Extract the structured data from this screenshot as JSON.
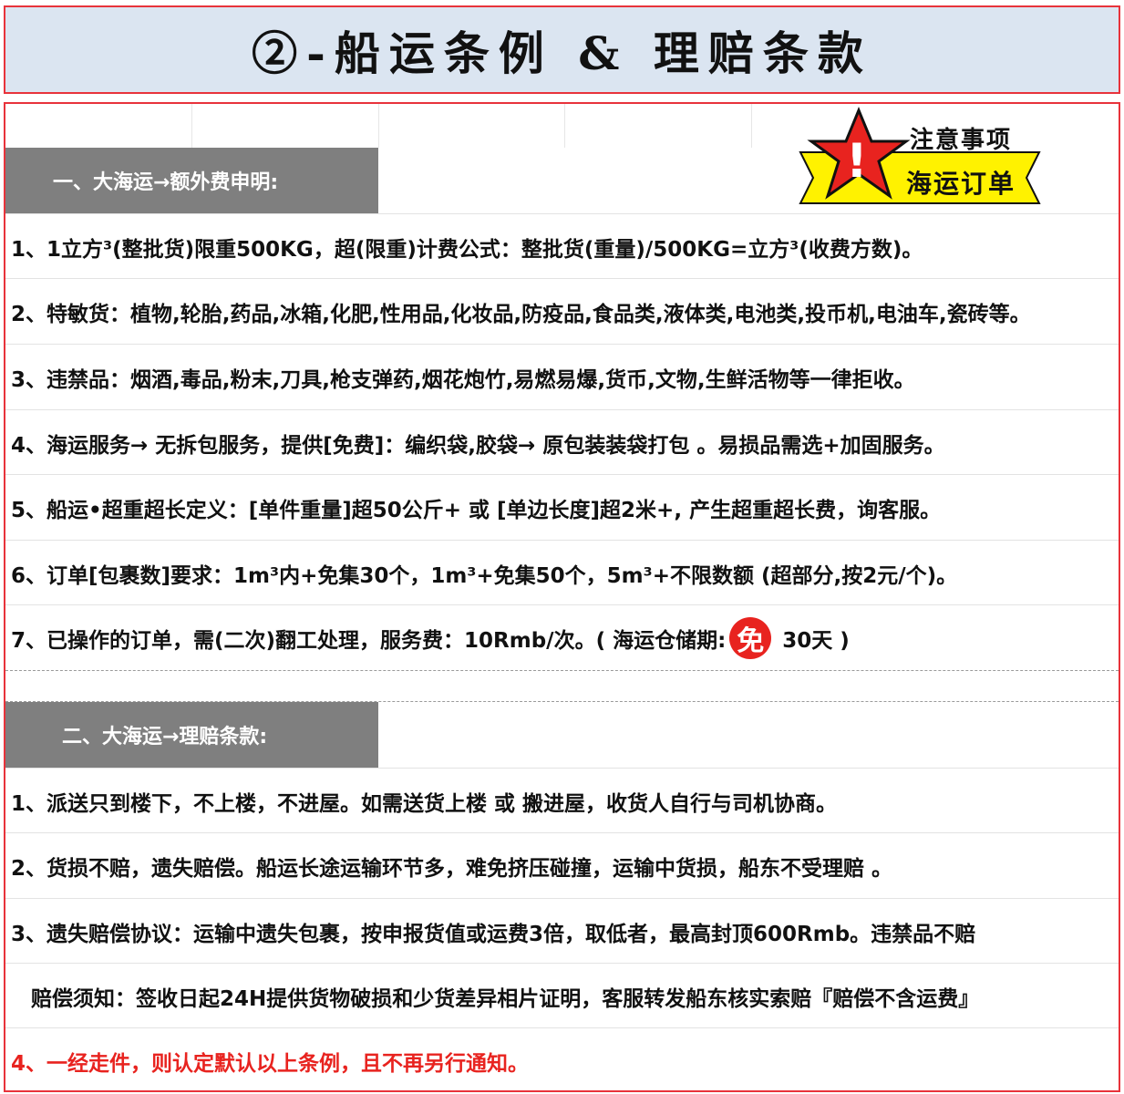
{
  "title": "②-船运条例 & 理赔条款",
  "notice": {
    "line1": "注意事项",
    "line2": "海运订单",
    "mark": "!"
  },
  "section1": {
    "header": "一、大海运→额外费申明:",
    "items": [
      "1、1立方³(整批货)限重500KG，超(限重)计费公式：整批货(重量)/500KG=立方³(收费方数)。",
      "2、特敏货：植物,轮胎,药品,冰箱,化肥,性用品,化妆品,防疫品,食品类,液体类,电池类,投币机,电油车,瓷砖等。",
      "3、违禁品：烟酒,毒品,粉末,刀具,枪支弹药,烟花炮竹,易燃易爆,货币,文物,生鲜活物等一律拒收。",
      "4、海运服务→ 无拆包服务，提供[免费]：编织袋,胶袋→ 原包装装袋打包 。易损品需选+加固服务。",
      "5、船运•超重超长定义：[单件重量]超50公斤+ 或  [单边长度]超2米+, 产生超重超长费，询客服。",
      "6、订单[包裹数]要求：1m³内+免集30个，1m³+免集50个，5m³+不限数额 (超部分,按2元/个)。"
    ],
    "item7": {
      "prefix": "7、已操作的订单，需(二次)翻工处理，服务费：10Rmb/次。( 海运仓储期:",
      "badge": "免",
      "suffix": "30天 )"
    }
  },
  "section2": {
    "header": "二、大海运→理赔条款:",
    "items": [
      "1、派送只到楼下，不上楼，不进屋。如需送货上楼 或 搬进屋，收货人自行与司机协商。",
      "2、货损不赔，遗失赔偿。船运长途运输环节多，难免挤压碰撞，运输中货损，船东不受理赔 。",
      "3、遗失赔偿协议：运输中遗失包裹，按申报货值或运费3倍，取低者，最高封顶600Rmb。违禁品不赔",
      "赔偿须知：签收日起24H提供货物破损和少货差异相片证明，客服转发船东核实索赔『赔偿不含运费』"
    ],
    "final": "4、一经走件，则认定默认以上条例，且不再另行通知。"
  },
  "colors": {
    "accent_red": "#e8333b",
    "title_bg": "#dbe5f1",
    "header_bg": "#7f7f7f",
    "notice_yellow": "#fff200"
  }
}
